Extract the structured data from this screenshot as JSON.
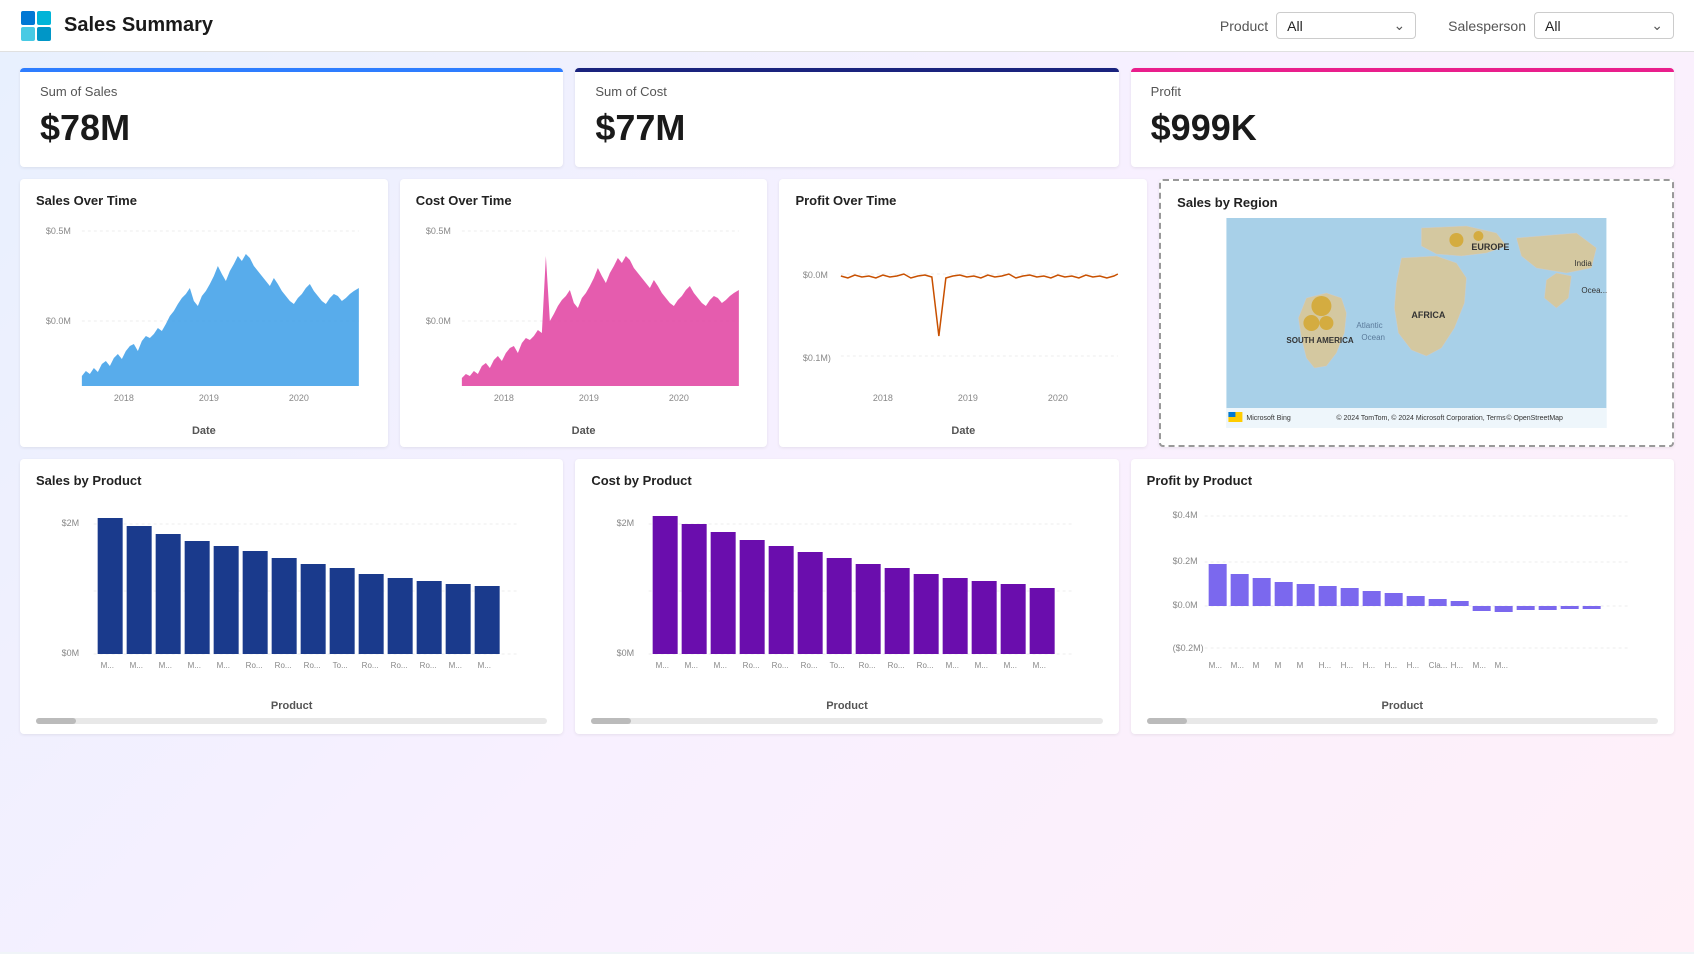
{
  "header": {
    "title": "Sales Summary",
    "logo_icon": "chart-icon",
    "filters": [
      {
        "label": "Product",
        "value": "All",
        "id": "product-filter"
      },
      {
        "label": "Salesperson",
        "value": "All",
        "id": "salesperson-filter"
      }
    ]
  },
  "kpis": [
    {
      "id": "sum-sales",
      "label": "Sum of Sales",
      "value": "$78M",
      "color_class": "blue"
    },
    {
      "id": "sum-cost",
      "label": "Sum of Cost",
      "value": "$77M",
      "color_class": "navy"
    },
    {
      "id": "profit",
      "label": "Profit",
      "value": "$999K",
      "color_class": "pink"
    }
  ],
  "charts_row1": [
    {
      "id": "sales-over-time",
      "title": "Sales Over Time",
      "axis_label": "Date",
      "color": "#3b9de8"
    },
    {
      "id": "cost-over-time",
      "title": "Cost Over Time",
      "axis_label": "Date",
      "color": "#e040a0"
    },
    {
      "id": "profit-over-time",
      "title": "Profit Over Time",
      "axis_label": "Date",
      "color": "#c85000"
    },
    {
      "id": "sales-by-region",
      "title": "Sales by Region"
    }
  ],
  "charts_row2": [
    {
      "id": "sales-by-product",
      "title": "Sales by Product",
      "axis_label": "Product",
      "color": "#1a3a8c"
    },
    {
      "id": "cost-by-product",
      "title": "Cost by Product",
      "axis_label": "Product",
      "color": "#6a0dad"
    },
    {
      "id": "profit-by-product",
      "title": "Profit by Product",
      "axis_label": "Product",
      "color": "#7b68ee"
    }
  ],
  "map": {
    "copyright": "© 2024 TomTom, © 2024 Microsoft Corporation, Terms",
    "copyright2": "© OpenStreetMap",
    "labels": [
      "EUROPE",
      "AFRICA",
      "SOUTH AMERICA",
      "Atlantic Ocean",
      "India",
      "Ocea..."
    ]
  }
}
